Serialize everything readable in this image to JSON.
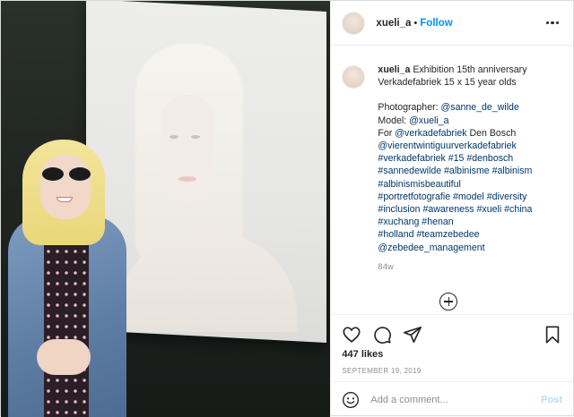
{
  "header": {
    "username": "xueli_a",
    "separator": "•",
    "follow_label": "Follow",
    "more_icon": "more-options-icon"
  },
  "caption": {
    "username": "xueli_a",
    "lines": [
      "Exhibition 15th anniversary",
      "Verkadefabriek 15 x 15 year olds"
    ],
    "photographer_label": "Photographer: ",
    "photographer_link": "@sanne_de_wilde",
    "model_label": "Model: ",
    "model_link": "@xueli_a",
    "for_label": "For ",
    "for_link": "@verkadefabriek",
    "for_suffix": " Den Bosch",
    "tag_lines": [
      "@vierentwintiguurverkadefabriek",
      "#verkadefabriek #15 #denbosch",
      "#sannedewilde #albinisme #albinism",
      "#albinismisbeautiful",
      "#portretfotografie #model #diversity",
      "#inclusion #awareness #xueli #china",
      "#xuchang #henan",
      "#holland #teamzebedee",
      "@zebedee_management"
    ],
    "age": "84w"
  },
  "actions": {
    "like_icon": "heart-icon",
    "comment_icon": "comment-icon",
    "share_icon": "share-icon",
    "save_icon": "bookmark-icon",
    "likes": "447 likes",
    "date": "SEPTEMBER 19, 2019"
  },
  "comment_box": {
    "emoji_icon": "emoji-icon",
    "placeholder": "Add a comment...",
    "post_label": "Post"
  },
  "colors": {
    "accent": "#0095f6",
    "link": "#00376b",
    "muted": "#8e8e8e",
    "post_disabled": "#b2dffc"
  }
}
